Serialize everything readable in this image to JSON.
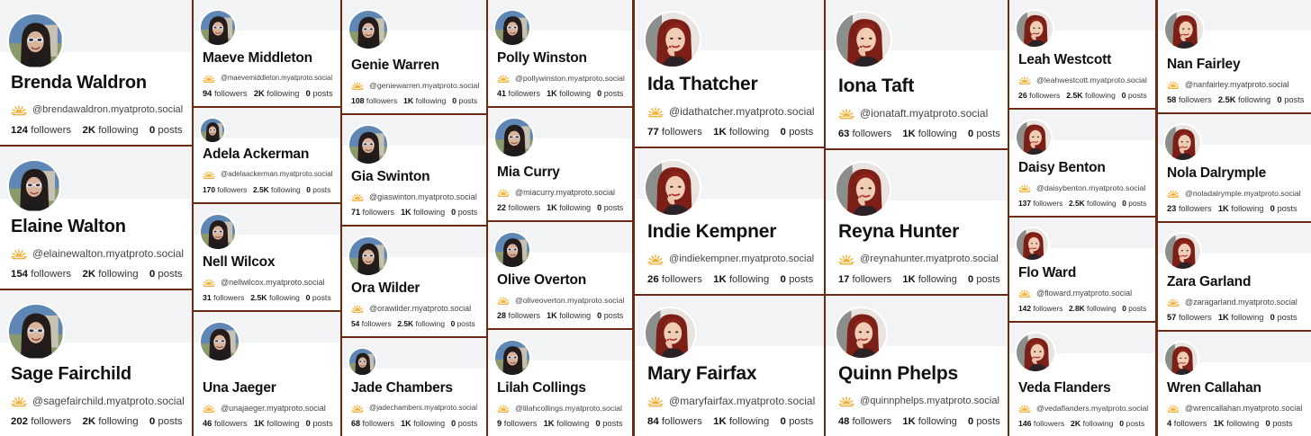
{
  "columns": [
    {
      "tier": "xl",
      "avatar": "brunette-sunglasses",
      "profiles": [
        {
          "name": "Brenda Waldron",
          "handle": "@brendawaldron.myatproto.social",
          "followers": "124",
          "following": "2K",
          "posts": "0"
        },
        {
          "name": "Elaine Walton",
          "handle": "@elainewalton.myatproto.social",
          "followers": "154",
          "following": "2K",
          "posts": "0"
        },
        {
          "name": "Sage Fairchild",
          "handle": "@sagefairchild.myatproto.social",
          "followers": "202",
          "following": "2K",
          "posts": "0"
        }
      ]
    },
    {
      "tier": "s",
      "avatar": "brunette-sunglasses",
      "profiles": [
        {
          "name": "Maeve Middleton",
          "handle": "@maevemiddleton.myatproto.social",
          "followers": "94",
          "following": "2K",
          "posts": "0"
        },
        {
          "name": "Adela Ackerman",
          "handle": "@adelaackerman.myatproto.social",
          "followers": "170",
          "following": "2.5K",
          "posts": "0"
        },
        {
          "name": "Nell Wilcox",
          "handle": "@nellwilcox.myatproto.social",
          "followers": "31",
          "following": "2.5K",
          "posts": "0"
        },
        {
          "name": "Una Jaeger",
          "handle": "@unajaeger.myatproto.social",
          "followers": "46",
          "following": "1K",
          "posts": "0"
        }
      ]
    },
    {
      "tier": "s",
      "avatar": "brunette-sunglasses",
      "profiles": [
        {
          "name": "Genie Warren",
          "handle": "@geniewarren.myatproto.social",
          "followers": "108",
          "following": "1K",
          "posts": "0"
        },
        {
          "name": "Gia Swinton",
          "handle": "@giaswinton.myatproto.social",
          "followers": "71",
          "following": "1K",
          "posts": "0"
        },
        {
          "name": "Ora Wilder",
          "handle": "@orawilder.myatproto.social",
          "followers": "54",
          "following": "2.5K",
          "posts": "0"
        },
        {
          "name": "Jade Chambers",
          "handle": "@jadechambers.myatproto.social",
          "followers": "68",
          "following": "1K",
          "posts": "0"
        }
      ]
    },
    {
      "tier": "s",
      "avatar": "brunette-sunglasses",
      "profiles": [
        {
          "name": "Polly Winston",
          "handle": "@pollywinston.myatproto.social",
          "followers": "41",
          "following": "1K",
          "posts": "0"
        },
        {
          "name": "Mia Curry",
          "handle": "@miacurry.myatproto.social",
          "followers": "22",
          "following": "1K",
          "posts": "0"
        },
        {
          "name": "Olive Overton",
          "handle": "@oliveoverton.myatproto.social",
          "followers": "28",
          "following": "1K",
          "posts": "0"
        },
        {
          "name": "Lilah Collings",
          "handle": "@lilahcollings.myatproto.social",
          "followers": "9",
          "following": "1K",
          "posts": "0"
        }
      ]
    },
    {
      "tier": "l",
      "avatar": "redhead",
      "profiles": [
        {
          "name": "Ida Thatcher",
          "handle": "@idathatcher.myatproto.social",
          "followers": "77",
          "following": "1K",
          "posts": "0"
        },
        {
          "name": "Indie Kempner",
          "handle": "@indiekempner.myatproto.social",
          "followers": "26",
          "following": "1K",
          "posts": "0"
        },
        {
          "name": "Mary Fairfax",
          "handle": "@maryfairfax.myatproto.social",
          "followers": "84",
          "following": "1K",
          "posts": "0"
        }
      ]
    },
    {
      "tier": "l",
      "avatar": "redhead",
      "profiles": [
        {
          "name": "Iona Taft",
          "handle": "@ionataft.myatproto.social",
          "followers": "63",
          "following": "1K",
          "posts": "0"
        },
        {
          "name": "Reyna Hunter",
          "handle": "@reynahunter.myatproto.social",
          "followers": "17",
          "following": "1K",
          "posts": "0"
        },
        {
          "name": "Quinn Phelps",
          "handle": "@quinnphelps.myatproto.social",
          "followers": "48",
          "following": "1K",
          "posts": "0"
        }
      ]
    },
    {
      "tier": "s",
      "avatar": "redhead",
      "profiles": [
        {
          "name": "Leah Westcott",
          "handle": "@leahwestcott.myatproto.social",
          "followers": "26",
          "following": "2.5K",
          "posts": "0"
        },
        {
          "name": "Daisy Benton",
          "handle": "@daisybenton.myatproto.social",
          "followers": "137",
          "following": "2.5K",
          "posts": "0"
        },
        {
          "name": "Flo Ward",
          "handle": "@floward.myatproto.social",
          "followers": "142",
          "following": "2.8K",
          "posts": "0"
        },
        {
          "name": "Veda Flanders",
          "handle": "@vedaflanders.myatproto.social",
          "followers": "146",
          "following": "2K",
          "posts": "0"
        }
      ]
    },
    {
      "tier": "s",
      "avatar": "redhead",
      "profiles": [
        {
          "name": "Nan Fairley",
          "handle": "@nanfairley.myatproto.social",
          "followers": "58",
          "following": "2.5K",
          "posts": "0"
        },
        {
          "name": "Nola Dalrymple",
          "handle": "@noladalrymple.myatproto.social",
          "followers": "23",
          "following": "1K",
          "posts": "0"
        },
        {
          "name": "Zara Garland",
          "handle": "@zaragarland.myatproto.social",
          "followers": "57",
          "following": "1K",
          "posts": "0"
        },
        {
          "name": "Wren Callahan",
          "handle": "@wrencallahan.myatproto.social",
          "followers": "4",
          "following": "1K",
          "posts": "0"
        }
      ]
    }
  ],
  "labels": {
    "followers": "followers",
    "following": "following",
    "posts": "posts"
  },
  "icons": {
    "handle": "sun-icon",
    "avatar": "profile-photo"
  },
  "colors": {
    "sun": "#f2b33d",
    "border": "#6b2a14",
    "banner": "#f2f3f5"
  }
}
